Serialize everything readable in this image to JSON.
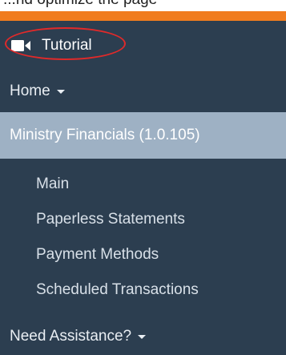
{
  "top_strip": {
    "text": "...nd optimize the page"
  },
  "colors": {
    "orange_bar": "#f07c1e",
    "sidebar_bg": "#2c3e50",
    "active_bg": "#9eb1c4",
    "highlight_ring": "#e02a2a"
  },
  "sidebar": {
    "tutorial": {
      "label": "Tutorial",
      "icon": "video-camera-icon"
    },
    "home": {
      "label": "Home",
      "icon": "caret-down-icon"
    },
    "active_section": {
      "label": "Ministry Financials (1.0.105)"
    },
    "sub_items": [
      {
        "label": "Main"
      },
      {
        "label": "Paperless Statements"
      },
      {
        "label": "Payment Methods"
      },
      {
        "label": "Scheduled Transactions"
      }
    ],
    "assistance": {
      "label": "Need Assistance?",
      "icon": "caret-down-icon"
    }
  }
}
